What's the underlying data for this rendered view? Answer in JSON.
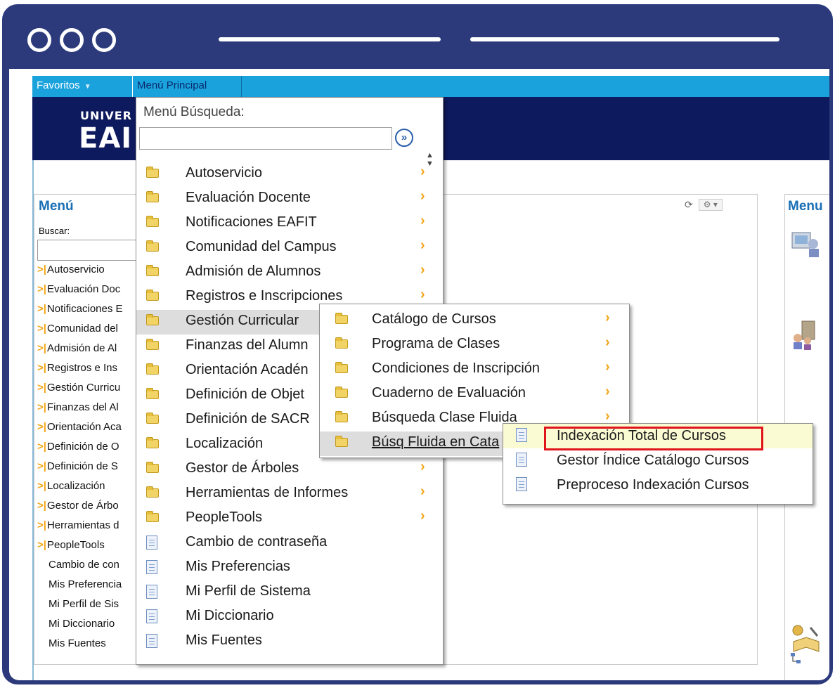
{
  "topnav": {
    "favorites_label": "Favoritos",
    "main_menu_label": "Menú Principal"
  },
  "banner": {
    "logo_line1": "UNIVER",
    "logo_line2": "EAI"
  },
  "menu_pagelet": {
    "title": "Menú",
    "search_label": "Buscar:",
    "items": [
      {
        "label": "Autoservicio",
        "arrow": true
      },
      {
        "label": "Evaluación Doc",
        "arrow": true
      },
      {
        "label": "Notificaciones E",
        "arrow": true
      },
      {
        "label": "Comunidad del",
        "arrow": true
      },
      {
        "label": "Admisión de Al",
        "arrow": true
      },
      {
        "label": "Registros e Ins",
        "arrow": true
      },
      {
        "label": "Gestión Curricu",
        "arrow": true
      },
      {
        "label": "Finanzas del Al",
        "arrow": true
      },
      {
        "label": "Orientación Aca",
        "arrow": true
      },
      {
        "label": "Definición de O",
        "arrow": true
      },
      {
        "label": "Definición de S",
        "arrow": true
      },
      {
        "label": "Localización",
        "arrow": true
      },
      {
        "label": "Gestor de Árbo",
        "arrow": true
      },
      {
        "label": "Herramientas d",
        "arrow": true
      },
      {
        "label": "PeopleTools",
        "arrow": true
      },
      {
        "label": "Cambio de con",
        "arrow": false
      },
      {
        "label": "Mis Preferencia",
        "arrow": false
      },
      {
        "label": "Mi Perfil de Sis",
        "arrow": false
      },
      {
        "label": "Mi Diccionario",
        "arrow": false
      },
      {
        "label": "Mis Fuentes",
        "arrow": false
      }
    ]
  },
  "right_pagelet": {
    "title": "Menu"
  },
  "dropdown_main": {
    "search_label": "Menú Búsqueda:",
    "items": [
      {
        "label": "Autoservicio",
        "type": "folder",
        "chevron": true
      },
      {
        "label": "Evaluación Docente",
        "type": "folder",
        "chevron": true
      },
      {
        "label": "Notificaciones EAFIT",
        "type": "folder",
        "chevron": true
      },
      {
        "label": "Comunidad del Campus",
        "type": "folder",
        "chevron": true
      },
      {
        "label": "Admisión de Alumnos",
        "type": "folder",
        "chevron": true
      },
      {
        "label": "Registros e Inscripciones",
        "type": "folder",
        "chevron": true
      },
      {
        "label": "Gestión Curricular",
        "type": "folder",
        "chevron": true,
        "highlighted": true
      },
      {
        "label": "Finanzas del Alumn",
        "type": "folder",
        "chevron": true
      },
      {
        "label": "Orientación Acadén",
        "type": "folder",
        "chevron": true
      },
      {
        "label": "Definición de Objet",
        "type": "folder",
        "chevron": true
      },
      {
        "label": "Definición de SACR",
        "type": "folder",
        "chevron": true
      },
      {
        "label": "Localización",
        "type": "folder",
        "chevron": true
      },
      {
        "label": "Gestor de Árboles",
        "type": "folder",
        "chevron": true
      },
      {
        "label": "Herramientas de Informes",
        "type": "folder",
        "chevron": true
      },
      {
        "label": "PeopleTools",
        "type": "folder",
        "chevron": true
      },
      {
        "label": "Cambio de contraseña",
        "type": "doc",
        "chevron": false
      },
      {
        "label": "Mis Preferencias",
        "type": "doc",
        "chevron": false
      },
      {
        "label": "Mi Perfil de Sistema",
        "type": "doc",
        "chevron": false
      },
      {
        "label": "Mi Diccionario",
        "type": "doc",
        "chevron": false
      },
      {
        "label": "Mis Fuentes",
        "type": "doc",
        "chevron": false
      }
    ]
  },
  "dropdown_sub": {
    "items": [
      {
        "label": "Catálogo de Cursos",
        "chevron": true
      },
      {
        "label": "Programa de Clases",
        "chevron": true
      },
      {
        "label": "Condiciones de Inscripción",
        "chevron": true
      },
      {
        "label": "Cuaderno de Evaluación",
        "chevron": true
      },
      {
        "label": "Búsqueda Clase Fluida",
        "chevron": true
      },
      {
        "label": "Búsq Fluida en Cata",
        "chevron": true,
        "highlighted": true
      }
    ]
  },
  "dropdown_sub2": {
    "items": [
      {
        "label": "Indexación Total de Cursos",
        "highlighted": true
      },
      {
        "label": "Gestor Índice Catálogo Cursos"
      },
      {
        "label": "Preproceso Indexación Cursos"
      }
    ]
  },
  "colors": {
    "frame": "#2c3a7c",
    "topnav": "#1aa2dc",
    "banner": "#0e1a5e",
    "highlight_box": "#e0141b",
    "chevron": "#f3a516"
  }
}
